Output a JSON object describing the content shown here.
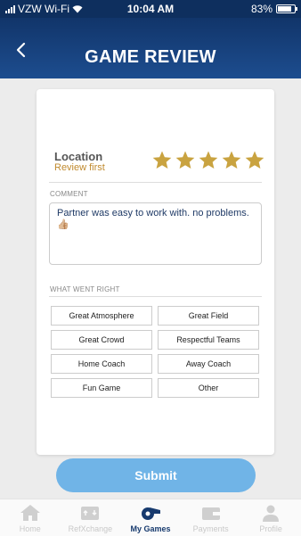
{
  "status_bar": {
    "carrier": "VZW Wi-Fi",
    "time": "10:04 AM",
    "battery": "83%"
  },
  "header": {
    "title": "GAME REVIEW"
  },
  "review": {
    "location_label": "Location",
    "location_sub": "Review first",
    "rating": 5,
    "max_rating": 5,
    "comment_label": "COMMENT",
    "comment_text": "Partner was easy to work with. no problems. 👍🏼",
    "went_right_label": "WHAT WENT RIGHT",
    "tags": [
      "Great Atmosphere",
      "Great Field",
      "Great Crowd",
      "Respectful Teams",
      "Home Coach",
      "Away Coach",
      "Fun Game",
      "Other"
    ]
  },
  "submit": {
    "label": "Submit"
  },
  "tabbar": {
    "items": [
      {
        "label": "Home",
        "icon": "home-icon"
      },
      {
        "label": "RefXchange",
        "icon": "exchange-icon"
      },
      {
        "label": "My Games",
        "icon": "whistle-icon"
      },
      {
        "label": "Payments",
        "icon": "wallet-icon"
      },
      {
        "label": "Profile",
        "icon": "person-icon"
      }
    ],
    "active_index": 2
  },
  "colors": {
    "header": "#11356a",
    "star": "#c9a340",
    "submit": "#70b4e7",
    "accent_text": "#c08a2e"
  }
}
